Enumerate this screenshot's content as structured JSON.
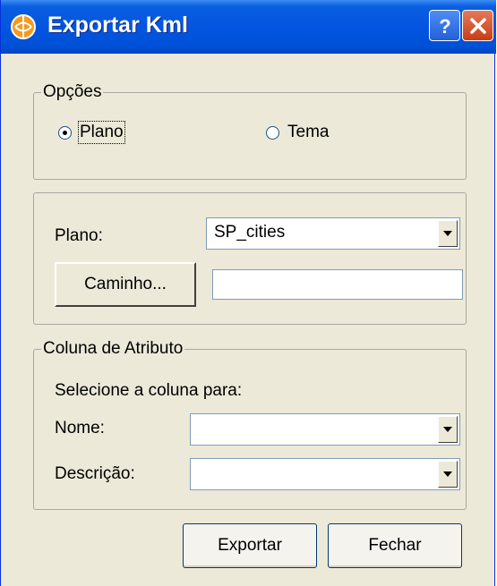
{
  "window": {
    "title": "Exportar Kml"
  },
  "options_group": {
    "legend": "Opções",
    "plano_label": "Plano",
    "tema_label": "Tema",
    "selected": "Plano"
  },
  "plan_section": {
    "plano_label": "Plano:",
    "plano_value": "SP_cities",
    "caminho_button": "Caminho...",
    "caminho_value": ""
  },
  "attribute_group": {
    "legend": "Coluna de Atributo",
    "instruction": "Selecione a coluna para:",
    "nome_label": "Nome:",
    "nome_value": "",
    "descricao_label": "Descrição:",
    "descricao_value": ""
  },
  "buttons": {
    "exportar": "Exportar",
    "fechar": "Fechar"
  },
  "icons": {
    "app": "exportar-kml-app-icon",
    "help": "help-icon",
    "close": "close-icon",
    "dropdown": "chevron-down-icon"
  },
  "colors": {
    "titlebar": "#0355e0",
    "face": "#ece9d8",
    "close": "#c93c17"
  }
}
